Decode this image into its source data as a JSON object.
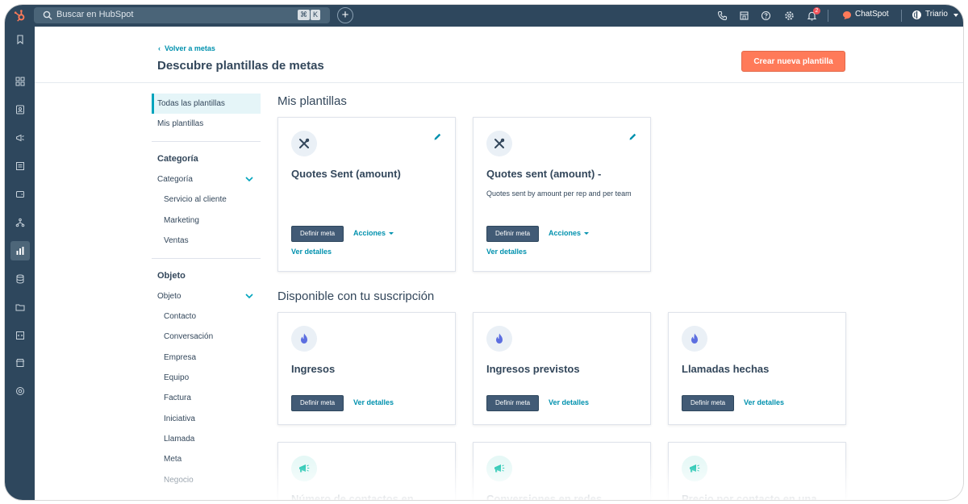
{
  "topbar": {
    "search_placeholder": "Buscar en HubSpot",
    "shortcut_keys": [
      "⌘",
      "K"
    ],
    "notifications_count": "2",
    "chatspot_label": "ChatSpot",
    "user_label": "Triario",
    "colors": {
      "bar": "#2e475d",
      "accent": "#ff7a59"
    }
  },
  "header": {
    "back_link": "Volver a metas",
    "title": "Descubre plantillas de metas",
    "create_button": "Crear nueva plantilla"
  },
  "sidebar": {
    "items": [
      "Todas las plantillas",
      "Mis plantillas"
    ],
    "category_heading": "Categoría",
    "category_group": "Categoría",
    "category_options": [
      "Servicio al cliente",
      "Marketing",
      "Ventas"
    ],
    "object_heading": "Objeto",
    "object_group": "Objeto",
    "object_options": [
      "Contacto",
      "Conversación",
      "Empresa",
      "Equipo",
      "Factura",
      "Iniciativa",
      "Llamada",
      "Meta",
      "Negocio"
    ]
  },
  "my_templates": {
    "title": "Mis plantillas",
    "cards": [
      {
        "title": "Quotes Sent (amount)",
        "description": "",
        "primary": "Definir meta",
        "actions": "Acciones",
        "details": "Ver detalles",
        "icon": "tools-icon"
      },
      {
        "title": "Quotes sent (amount) -",
        "description": "Quotes sent by amount per rep and per team",
        "primary": "Definir meta",
        "actions": "Acciones",
        "details": "Ver detalles",
        "icon": "tools-icon"
      }
    ]
  },
  "subscription": {
    "title": "Disponible con tu suscripción",
    "cards": [
      {
        "title": "Ingresos",
        "primary": "Definir meta",
        "details": "Ver detalles",
        "icon": "flame-icon"
      },
      {
        "title": "Ingresos previstos",
        "primary": "Definir meta",
        "details": "Ver detalles",
        "icon": "flame-icon"
      },
      {
        "title": "Llamadas hechas",
        "primary": "Definir meta",
        "details": "Ver detalles",
        "icon": "flame-icon"
      },
      {
        "title": "Número de contactos en",
        "icon": "megaphone-icon"
      },
      {
        "title": "Conversiones en redes",
        "icon": "megaphone-icon"
      },
      {
        "title": "Precio por contacto en una",
        "icon": "megaphone-icon"
      }
    ]
  }
}
